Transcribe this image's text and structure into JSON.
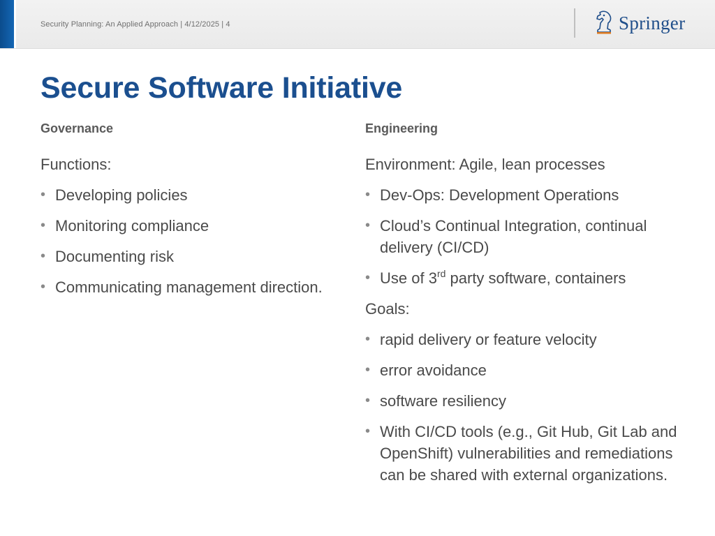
{
  "header": {
    "footer_text": "Security Planning: An Applied Approach | 4/12/2025 | 4",
    "logo_text": "Springer",
    "logo_icon": "springer-chess-knight-icon"
  },
  "colors": {
    "accent": "#1466b4",
    "title": "#1b4f8f",
    "logo": "#1f4e8a"
  },
  "slide": {
    "title": "Secure Software Initiative"
  },
  "left_column": {
    "heading": "Governance",
    "intro": "Functions:",
    "bullets": [
      "Developing policies",
      "Monitoring compliance",
      "Documenting risk",
      "Communicating management direction."
    ]
  },
  "right_column": {
    "heading": "Engineering",
    "intro": "Environment: Agile, lean processes",
    "bullets": [
      "Dev-Ops: Development Operations",
      "Cloud’s Continual Integration, continual delivery (CI/CD)"
    ],
    "third_party": {
      "prefix": "Use of 3",
      "superscript": "rd",
      "suffix": " party software, containers"
    },
    "goals_label": "Goals:",
    "goals": [
      "rapid delivery or feature velocity",
      "error avoidance",
      "software resiliency",
      "With CI/CD tools (e.g., Git Hub, Git Lab and OpenShift) vulnerabilities and remediations can be shared with external organizations."
    ]
  }
}
